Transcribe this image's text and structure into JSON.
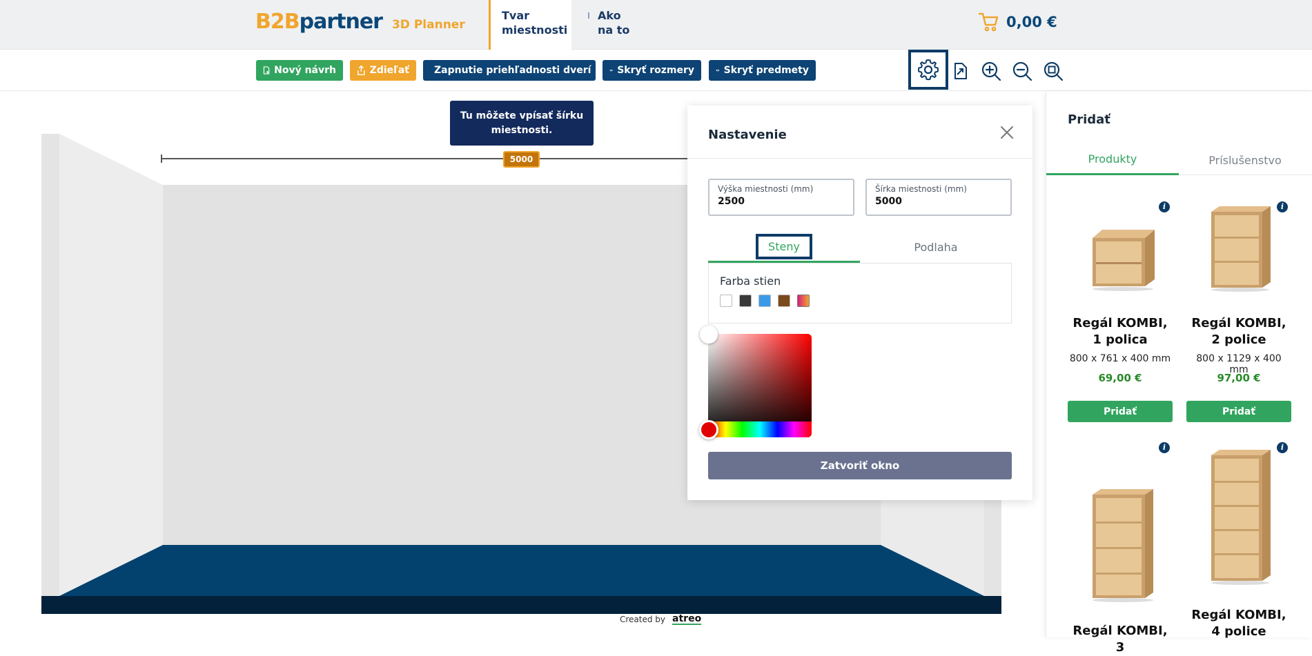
{
  "header": {
    "logo_b2b": "B2B",
    "logo_partner": "partner",
    "logo_subtitle": "3D Planner",
    "nav_active_line1": "Tvar",
    "nav_active_line2": "miestnosti",
    "nav_line1": "Ako",
    "nav_line2": "na to",
    "cart_total": "0,00 €"
  },
  "toolbar": {
    "new_design": "Nový návrh",
    "share": "Zdieľať",
    "door_transparency": "Zapnutie priehľadnosti dverí",
    "hide_dimensions": "Skryť rozmery",
    "hide_items": "Skryť predmety"
  },
  "canvas": {
    "tooltip": "Tu môžete vpísať šírku miestnosti.",
    "width_badge": "5000",
    "credit_prefix": "Created by",
    "credit_brand": "atreo"
  },
  "settings": {
    "title": "Nastavenie",
    "height_label": "Výška miestnosti (mm)",
    "height_value": "2500",
    "width_label": "Šírka miestnosti (mm)",
    "width_value": "5000",
    "tab_walls": "Steny",
    "tab_floor": "Podlaha",
    "wall_color_label": "Farba stien",
    "swatch_colors": [
      "#ffffff",
      "#3a3a3a",
      "#3b9ae8",
      "#7a4a1c",
      "gradient"
    ],
    "close_button": "Zatvoriť okno"
  },
  "sidebar": {
    "title": "Pridať",
    "tab_products": "Produkty",
    "tab_accessories": "Príslušenstvo",
    "products": [
      {
        "name": "Regál KOMBI, 1 polica",
        "dims": "800 x 761 x 400 mm",
        "price": "69,00 €",
        "add": "Pridať"
      },
      {
        "name": "Regál KOMBI, 2 police",
        "dims": "800 x 1129 x 400 mm",
        "price": "97,00 €",
        "add": "Pridať"
      },
      {
        "name": "Regál KOMBI, 3",
        "dims": "",
        "price": "",
        "add": ""
      },
      {
        "name": "Regál KOMBI, 4 police",
        "dims": "",
        "price": "",
        "add": ""
      }
    ]
  },
  "colors": {
    "brand_orange": "#f0a52c",
    "brand_navy": "#0d4375",
    "brand_green": "#31a55f",
    "floor": "#03426e"
  }
}
